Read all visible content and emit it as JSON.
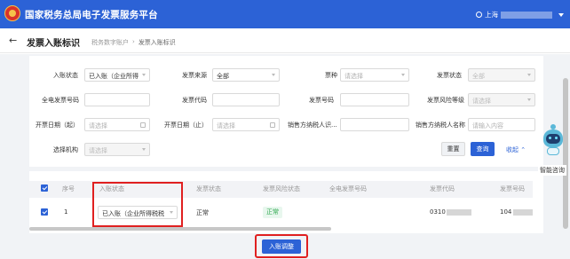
{
  "header": {
    "platform_title": "国家税务总局电子发票服务平台",
    "user_prefix": "上海"
  },
  "page": {
    "back_icon": "←",
    "title": "发票入账标识",
    "breadcrumb": [
      "税务数字账户",
      "发票入账标识"
    ]
  },
  "filters": {
    "entry_status_label": "入账状态",
    "entry_status_value": "已入账（企业所得",
    "invoice_source_label": "发票来源",
    "invoice_source_value": "全部",
    "ticket_type_label": "票种",
    "ticket_type_placeholder": "请选择",
    "invoice_status_label": "发票状态",
    "invoice_status_value": "全部",
    "full_invoice_no_label": "全电发票号码",
    "invoice_code_label": "发票代码",
    "invoice_no_label": "发票号码",
    "risk_level_label": "发票风险等级",
    "risk_level_placeholder": "请选择",
    "date_start_label": "开票日期（起）",
    "date_start_placeholder": "请选择",
    "date_end_label": "开票日期（止）",
    "date_end_placeholder": "请选择",
    "seller_tax_id_label": "销售方纳税人识...",
    "seller_name_label": "销售方纳税人名称",
    "seller_name_placeholder": "请输入内容",
    "org_label": "选择机构",
    "org_placeholder": "请选择"
  },
  "buttons": {
    "reset": "重置",
    "query": "查询",
    "collapse": "收起",
    "adjust": "入账调整"
  },
  "table": {
    "headers": [
      "序号",
      "入账状态",
      "发票状态",
      "发票风险状态",
      "全电发票号码",
      "发票代码",
      "发票号码"
    ],
    "rows": [
      {
        "index": "1",
        "entry_status": "已入账（企业所得税税",
        "invoice_status": "正常",
        "risk_status": "正常",
        "invoice_code_prefix": "0310",
        "invoice_no_prefix": "104"
      }
    ]
  },
  "assistant": {
    "label": "智能咨询"
  },
  "colors": {
    "brand_blue": "#2c62d6",
    "highlight_red": "#e02020",
    "normal_green": "#2fa84f"
  }
}
